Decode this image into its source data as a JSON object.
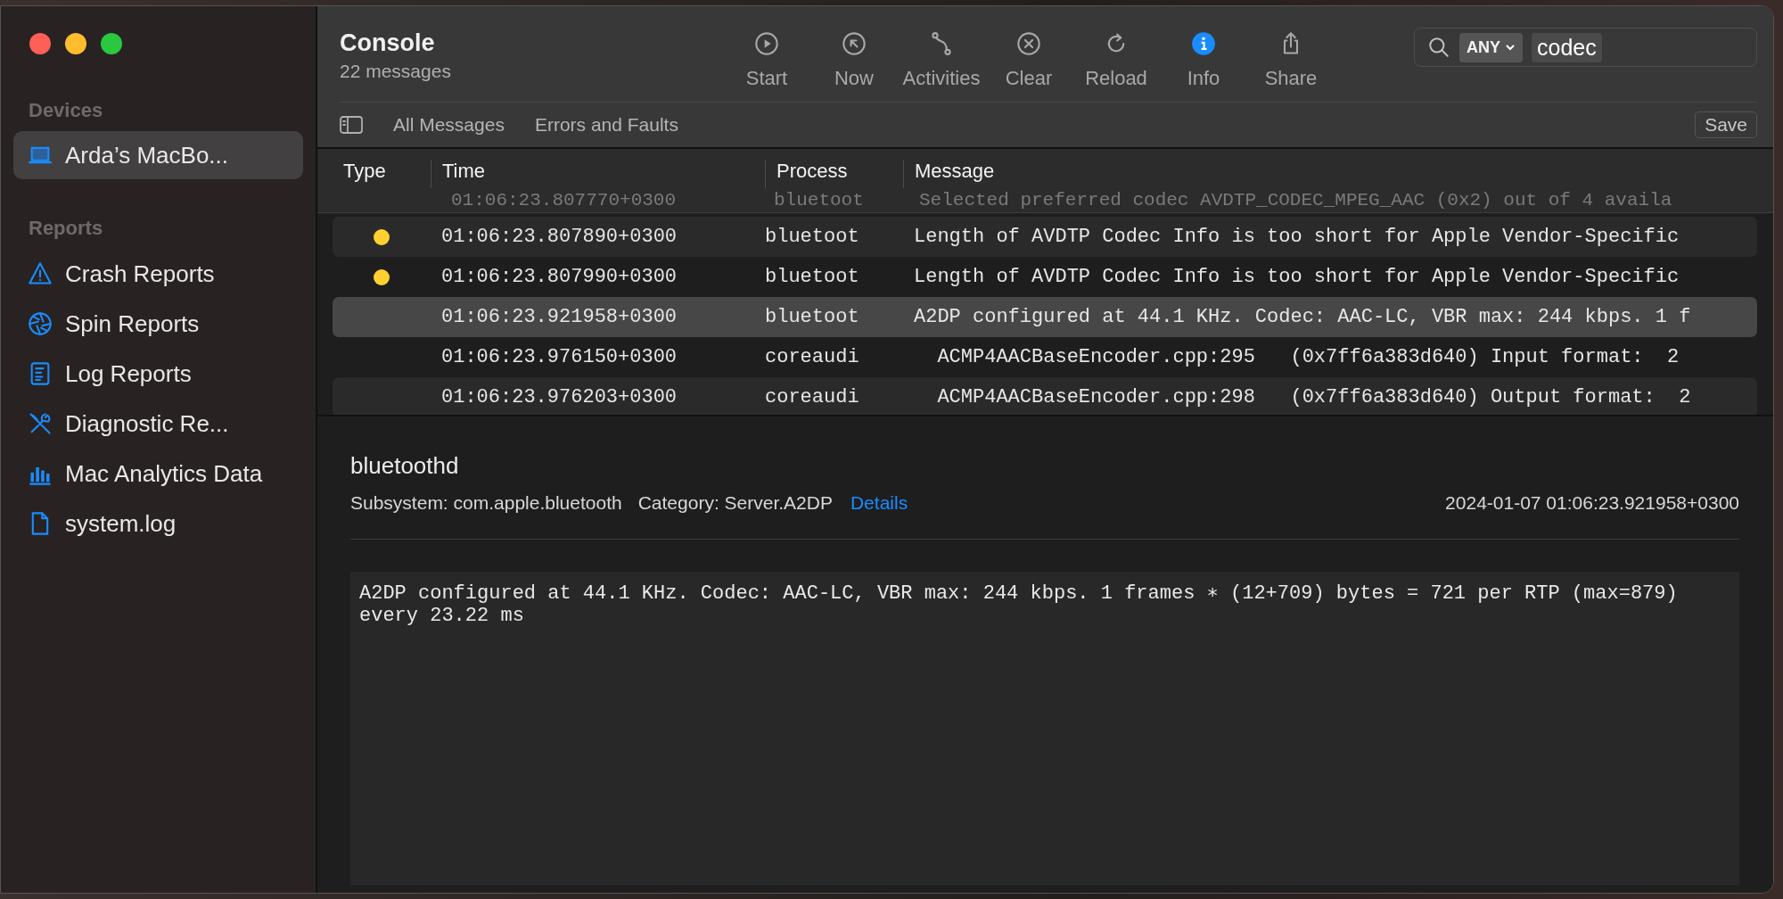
{
  "window": {
    "title": "Console",
    "subtitle": "22 messages"
  },
  "toolbar": [
    {
      "kind": "start",
      "label": "Start",
      "active": false
    },
    {
      "kind": "now",
      "label": "Now",
      "active": false
    },
    {
      "kind": "activities",
      "label": "Activities",
      "active": false
    },
    {
      "kind": "clear",
      "label": "Clear",
      "active": false
    },
    {
      "kind": "reload",
      "label": "Reload",
      "active": false
    },
    {
      "kind": "info",
      "label": "Info",
      "active": true
    },
    {
      "kind": "share",
      "label": "Share",
      "active": false
    }
  ],
  "search": {
    "scope": "ANY",
    "value": "codec"
  },
  "filters": [
    "All Messages",
    "Errors and Faults"
  ],
  "save_button": "Save",
  "sidebar": {
    "sections": [
      {
        "title": "Devices",
        "items": [
          {
            "kind": "laptop",
            "label": "Arda’s MacBo...",
            "selected": true
          }
        ]
      },
      {
        "title": "Reports",
        "items": [
          {
            "kind": "crash",
            "label": "Crash Reports",
            "selected": false
          },
          {
            "kind": "spin",
            "label": "Spin Reports",
            "selected": false
          },
          {
            "kind": "log",
            "label": "Log Reports",
            "selected": false
          },
          {
            "kind": "diagnostic",
            "label": "Diagnostic Re...",
            "selected": false
          },
          {
            "kind": "analytics",
            "label": "Mac Analytics Data",
            "selected": false
          },
          {
            "kind": "file",
            "label": "system.log",
            "selected": false
          }
        ]
      }
    ]
  },
  "table": {
    "columns": [
      "Type",
      "Time",
      "Process",
      "Message"
    ],
    "scrolled_row": {
      "time": "01:06:23.807770+0300",
      "process": "bluetoot",
      "message": "Selected preferred codec AVDTP_CODEC_MPEG_AAC (0x2) out of 4 availa"
    },
    "rows": [
      {
        "color": "#ffd02f",
        "time": "01:06:23.807890+0300",
        "process": "bluetoot",
        "message": "Length of AVDTP Codec Info is too short for Apple Vendor-Specific",
        "selected": false
      },
      {
        "color": "#ffd02f",
        "time": "01:06:23.807990+0300",
        "process": "bluetoot",
        "message": "Length of AVDTP Codec Info is too short for Apple Vendor-Specific",
        "selected": false
      },
      {
        "time": "01:06:23.921958+0300",
        "process": "bluetoot",
        "message": "A2DP configured at 44.1 KHz. Codec: AAC-LC, VBR max: 244 kbps. 1 f",
        "selected": true
      },
      {
        "time": "01:06:23.976150+0300",
        "process": "coreaudi",
        "message": "  ACMP4AACBaseEncoder.cpp:295   (0x7ff6a383d640) Input format:  2",
        "selected": false
      },
      {
        "time": "01:06:23.976203+0300",
        "process": "coreaudi",
        "message": "  ACMP4AACBaseEncoder.cpp:298   (0x7ff6a383d640) Output format:  2",
        "selected": false
      }
    ]
  },
  "detail": {
    "process": "bluetoothd",
    "subsystem": "Subsystem: com.apple.bluetooth",
    "category": "Category: Server.A2DP",
    "details_link": "Details",
    "timestamp": "2024-01-07 01:06:23.921958+0300",
    "message": "A2DP configured at 44.1 KHz. Codec: AAC-LC, VBR max: 244 kbps. 1 frames ∗ (12+709) bytes = 721 per RTP (max=879) every 23.22 ms"
  }
}
